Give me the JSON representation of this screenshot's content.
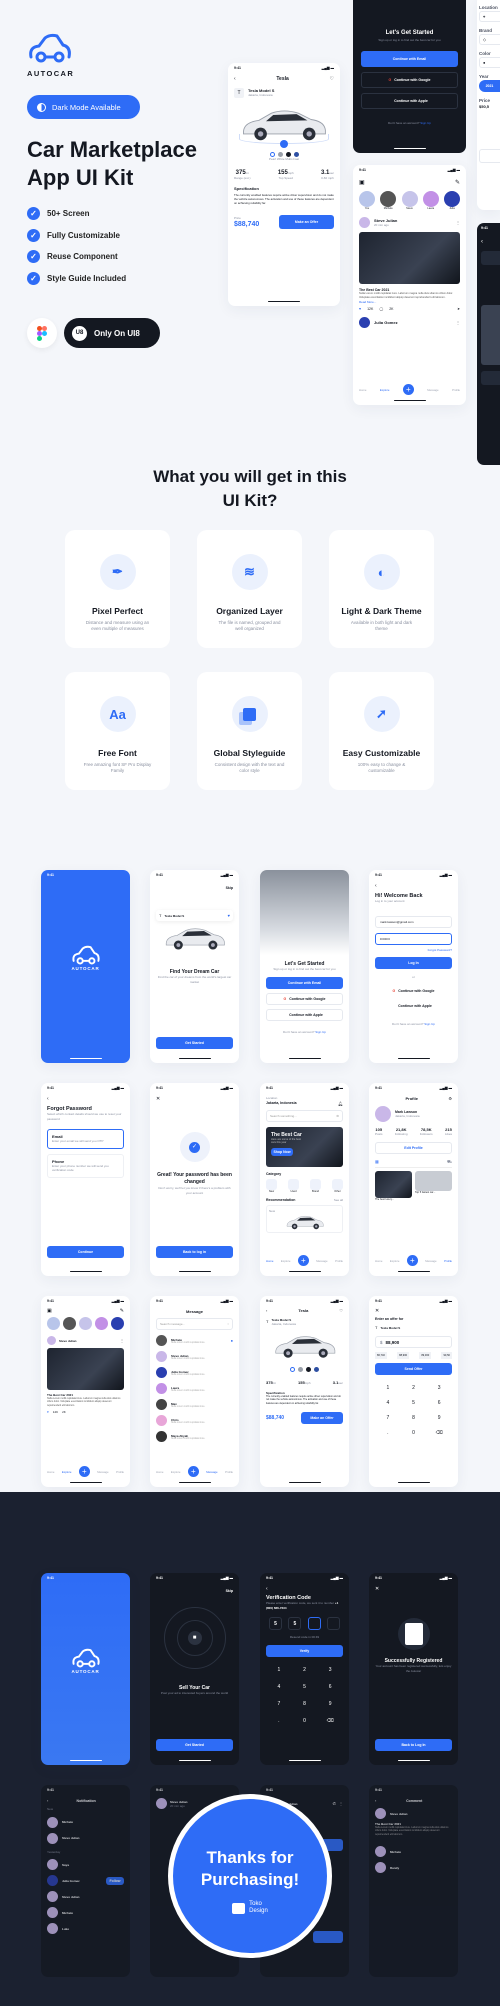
{
  "brand": {
    "name": "AUTOCAR",
    "accent": "#2e6cf6",
    "dark_bg": "#1b2130"
  },
  "hero": {
    "pill": "Dark Mode Available",
    "title_line1": "Car Marketplace",
    "title_line2": "App UI Kit",
    "features": [
      "50+ Screen",
      "Fully Customizable",
      "Reuse Component",
      "Style Guide Included"
    ],
    "ui8_label": "Only On UI8",
    "ui8_badge": "U8"
  },
  "status_time": "9:41",
  "detail": {
    "header": "Tesla",
    "model": "Tesla Model S",
    "location": "Jakarta, Indonesia",
    "color_name": "Pearl White Multi-Coat",
    "stats": [
      {
        "v": "375",
        "u": "mi",
        "l": "Range (est.)"
      },
      {
        "v": "155",
        "u": "mph",
        "l": "Top Speed"
      },
      {
        "v": "3.1",
        "u": "sec",
        "l": "0-60 mph"
      }
    ],
    "spec_title": "Specification",
    "spec_text": "The currently enabled features require active driver supervision and do not make the vehicle autonomous. The activation and use of these features are dependent on achieving reliability far.",
    "price_label": "Price",
    "price": "$88,740",
    "offer_btn": "Make an Offer"
  },
  "started": {
    "title": "Let's Get Started",
    "sub": "Sign up or log in to find out the best car for you",
    "email": "Continue with Email",
    "google": "Continue with Google",
    "apple": "Continue with Apple",
    "no_account": "Don't have an account?",
    "signup": "Sign Up"
  },
  "feed": {
    "stories": [
      "You",
      "Michele",
      "Steve",
      "Laura",
      "Julia"
    ],
    "author": "Steve Julian",
    "time": "20 min ago",
    "post_title": "The Best Car 2021",
    "post_text": "Nulla Lorem mollit cupidatat irure. Laborum magna nulla duis ullamco cillum dolor. Voluptate exercitation incididunt aliquip deserunt reprehenderit elit laborum.",
    "read_more": "Read More...",
    "likes": "12K",
    "comments": "2K",
    "author2": "Julia Gomez",
    "nav": [
      "Home",
      "Explore",
      "Message",
      "Profile"
    ]
  },
  "filter": {
    "labels": [
      "Location",
      "Brand",
      "Color",
      "Year",
      "Price"
    ],
    "year": "2021",
    "price": "$50,5"
  },
  "section2": {
    "title_line1": "What you will get in this",
    "title_line2": "UI Kit?",
    "cards": [
      {
        "icon": "pen-tool-icon",
        "title": "Pixel Perfect",
        "desc": "Distance and measure using an even multiple of measures"
      },
      {
        "icon": "layers-icon",
        "title": "Organized Layer",
        "desc": "The file is named, grouped and well organized"
      },
      {
        "icon": "contrast-icon",
        "title": "Light & Dark Theme",
        "desc": "Available in both light and dark theme"
      },
      {
        "icon": "font-icon",
        "glyph": "Aa",
        "title": "Free Font",
        "desc": "Free amazing font SF Pro Display Family"
      },
      {
        "icon": "styleguide-icon",
        "title": "Global Styleguide",
        "desc": "Consistent design with the text and color style"
      },
      {
        "icon": "cursor-click-icon",
        "title": "Easy Customizable",
        "desc": "100% easy to change & customizable"
      }
    ]
  },
  "onboard": {
    "skip": "Skip",
    "title": "Find Your Dream Car",
    "sub": "Find the car of your dreams from the world's largest car market",
    "cta": "Get Started"
  },
  "login": {
    "title": "Hi! Welcome Back",
    "sub": "Log in to your account",
    "email": "mark.lawson@gmail.com",
    "password": "••••••••",
    "forgot": "Forgot Password?",
    "login_btn": "Log In",
    "or": "or"
  },
  "forgot": {
    "title": "Forgot Password",
    "sub": "Select which contact details should we use to reset your password",
    "opt1": "Email",
    "opt1_desc": "Enter your email we will send you OTP",
    "opt2": "Phone",
    "opt2_desc": "Enter your phone number we will send you verification code",
    "cta": "Continue"
  },
  "changed": {
    "title": "Great! Your password has been changed",
    "sub": "Don't worry, we'll let you know if there's a problem with your account",
    "cta": "Back to log in"
  },
  "home": {
    "loc_label": "Location",
    "loc": "Jakarta, Indonesia",
    "search": "Search something...",
    "banner": "The Best Car",
    "banner_sub": "Here are some of the best cars this year",
    "shop": "Shop Now",
    "category": "Category",
    "cats": [
      "New",
      "Used",
      "Brand",
      "Other"
    ],
    "rec": "Recommendation",
    "see_all": "See all",
    "tag": "New"
  },
  "profile": {
    "title": "Profile",
    "name": "Mark Lawson",
    "loc": "Jakarta, Indonesia",
    "stats": [
      {
        "v": "105",
        "l": "Posts"
      },
      {
        "v": "21,8K",
        "l": "Following"
      },
      {
        "v": "78,5K",
        "l": "Followers"
      },
      {
        "v": "215",
        "l": "Likes"
      }
    ],
    "edit": "Edit Profile",
    "captions": [
      "The best luxury...",
      "Top 5 fastest car..."
    ]
  },
  "messages": {
    "title": "Message",
    "search": "Search message...",
    "items": [
      "Michele",
      "Steve Julian",
      "Julia Gomez",
      "Laura",
      "Max",
      "Chris",
      "Maya Aliyah"
    ],
    "preview": "Nulla Lorem mollit cupidatat irure."
  },
  "offer": {
    "title": "Enter an offer for",
    "model": "Tesla Model S",
    "currency": "$",
    "value": "88,900",
    "chips": [
      "86,740",
      "88,900",
      "89,300",
      "90,50"
    ],
    "send": "Send Offer",
    "keys": [
      "1",
      "2",
      "3",
      "4",
      "5",
      "6",
      "7",
      "8",
      "9",
      ".",
      "0",
      "⌫"
    ]
  },
  "sell": {
    "skip": "Skip",
    "title": "Sell Your Car",
    "sub": "Post your ad to interested buyers around the world",
    "cta": "Get Started"
  },
  "verify": {
    "title": "Verification Code",
    "sub": "Please enter verification code, we sent it to number",
    "phone": "+1 (800) 666-7234",
    "digits": [
      "5",
      "5",
      "",
      ""
    ],
    "resend": "Resend code in 00:49",
    "cta": "Verify"
  },
  "registered": {
    "title": "Successfully Registered",
    "sub": "Your account has been registered successfully, lets enjoy the Autocar",
    "cta": "Back to Log In"
  },
  "notif": {
    "title": "Notification",
    "new": "New",
    "yesterday": "Yesterday",
    "items": [
      "Michele",
      "Steve Julian",
      "Saya",
      "Julia Gomez",
      "Steve Julian",
      "Michele",
      "Luke"
    ],
    "follow": "Follow"
  },
  "chat": {
    "name": "Steve Julian",
    "status": "20 min ago"
  },
  "comment": {
    "title": "Comment",
    "author": "Steve Julian",
    "post": "The Best Car 2021",
    "items": [
      "Michele",
      "Randy"
    ]
  },
  "thanks": {
    "line1": "Thanks for",
    "line2": "Purchasing!",
    "studio1": "Toko",
    "studio2": "Design"
  }
}
